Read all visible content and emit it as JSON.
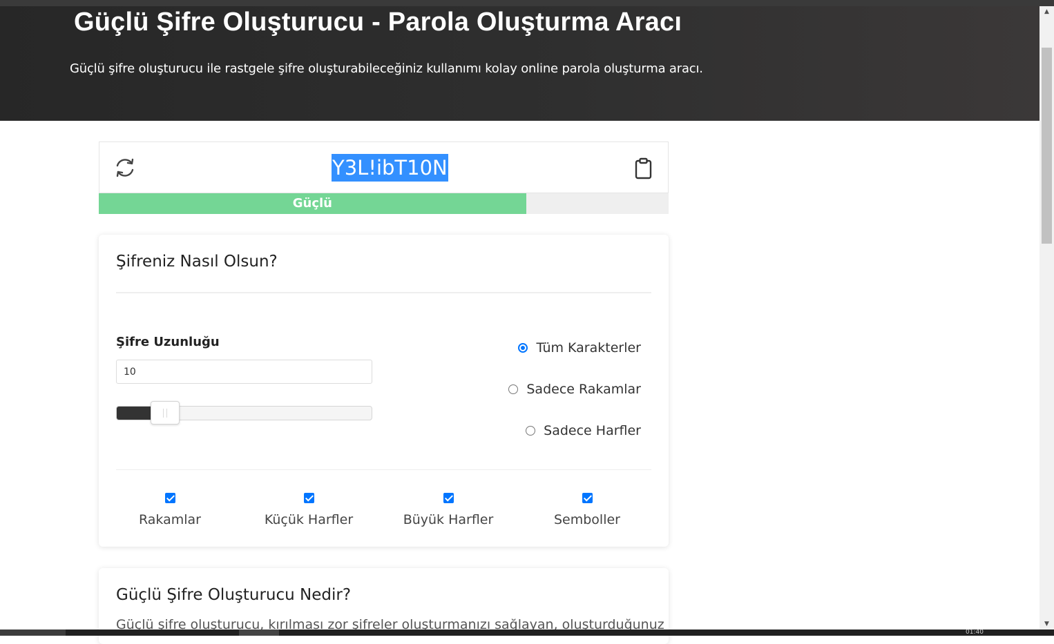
{
  "header": {
    "title": "Güçlü Şifre Oluşturucu - Parola Oluşturma Aracı",
    "subtitle": "Güçlü şifre oluşturucu ile rastgele şifre oluşturabileceğiniz kullanımı kolay online parola oluşturma aracı."
  },
  "generator": {
    "password": "Y3L!ibT10N",
    "refresh_icon": "refresh-icon",
    "copy_icon": "clipboard-icon",
    "strength_label": "Güçlü",
    "strength_fraction": 0.75,
    "strength_color": "#74d695"
  },
  "options": {
    "title": "Şifreniz Nasıl Olsun?",
    "length_label": "Şifre Uzunluğu",
    "length_value": "10",
    "length_slider_fraction": 0.14,
    "radios": [
      {
        "label": "Tüm Karakterler",
        "checked": true
      },
      {
        "label": "Sadece Rakamlar",
        "checked": false
      },
      {
        "label": "Sadece Harfler",
        "checked": false
      }
    ],
    "checkboxes": [
      {
        "label": "Rakamlar",
        "checked": true
      },
      {
        "label": "Küçük Harfler",
        "checked": true
      },
      {
        "label": "Büyük Harfler",
        "checked": true
      },
      {
        "label": "Semboller",
        "checked": true
      }
    ]
  },
  "info": {
    "title": "Güçlü Şifre Oluşturucu Nedir?",
    "text": "Güçlü şifre oluşturucu, kırılması zor şifreler oluşturmanızı sağlayan, oluşturduğunuz"
  },
  "colors": {
    "accent": "#0075ff",
    "selection": "#3390ff",
    "hero_bg": "#2f2f2f"
  },
  "taskbar": {
    "time_fragment": "01:40"
  }
}
